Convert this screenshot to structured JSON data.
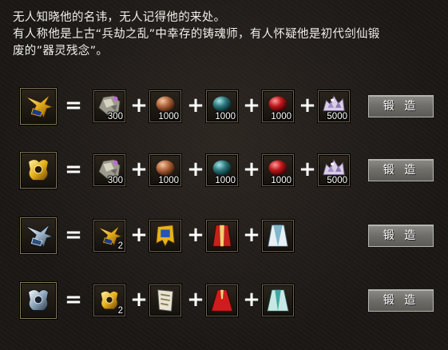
{
  "description": {
    "line1": "无人知晓他的名讳，无人记得他的来处。",
    "line2": "有人称他是上古“兵劫之乱”中幸存的铸魂师，有人怀疑他是初代剑仙锻",
    "line3": "废的”器灵残念”。"
  },
  "operators": {
    "equals": "=",
    "plus": "+"
  },
  "forge_button_label": "锻 造",
  "recipes": [
    {
      "result_icon": "gold-winged-helm-icon",
      "ingredients": [
        {
          "icon": "ore-stone-icon",
          "qty": "300"
        },
        {
          "icon": "copper-orb-icon",
          "qty": "1000"
        },
        {
          "icon": "teal-orb-icon",
          "qty": "1000"
        },
        {
          "icon": "red-orb-icon",
          "qty": "1000"
        },
        {
          "icon": "crystal-cluster-icon",
          "qty": "5000"
        }
      ]
    },
    {
      "result_icon": "gold-armor-icon",
      "ingredients": [
        {
          "icon": "ore-stone-icon",
          "qty": "300"
        },
        {
          "icon": "copper-orb-icon",
          "qty": "1000"
        },
        {
          "icon": "teal-orb-icon",
          "qty": "1000"
        },
        {
          "icon": "red-orb-icon",
          "qty": "1000"
        },
        {
          "icon": "crystal-cluster-icon",
          "qty": "5000"
        }
      ]
    },
    {
      "result_icon": "silver-winged-helm-icon",
      "ingredients": [
        {
          "icon": "gold-winged-helm-icon",
          "qty": "2"
        },
        {
          "icon": "gold-banner-icon",
          "qty": ""
        },
        {
          "icon": "red-robe-icon",
          "qty": ""
        },
        {
          "icon": "white-robe-icon",
          "qty": ""
        }
      ]
    },
    {
      "result_icon": "silver-armor-icon",
      "ingredients": [
        {
          "icon": "gold-armor-icon",
          "qty": "2"
        },
        {
          "icon": "white-scroll-icon",
          "qty": ""
        },
        {
          "icon": "red-cloak-icon",
          "qty": ""
        },
        {
          "icon": "cyan-robe-icon",
          "qty": ""
        }
      ]
    }
  ],
  "colors": {
    "background": "#1b1816",
    "slot_border": "#8a7c5c",
    "button_bg": "#6f6d68",
    "text": "#f0efe9"
  }
}
